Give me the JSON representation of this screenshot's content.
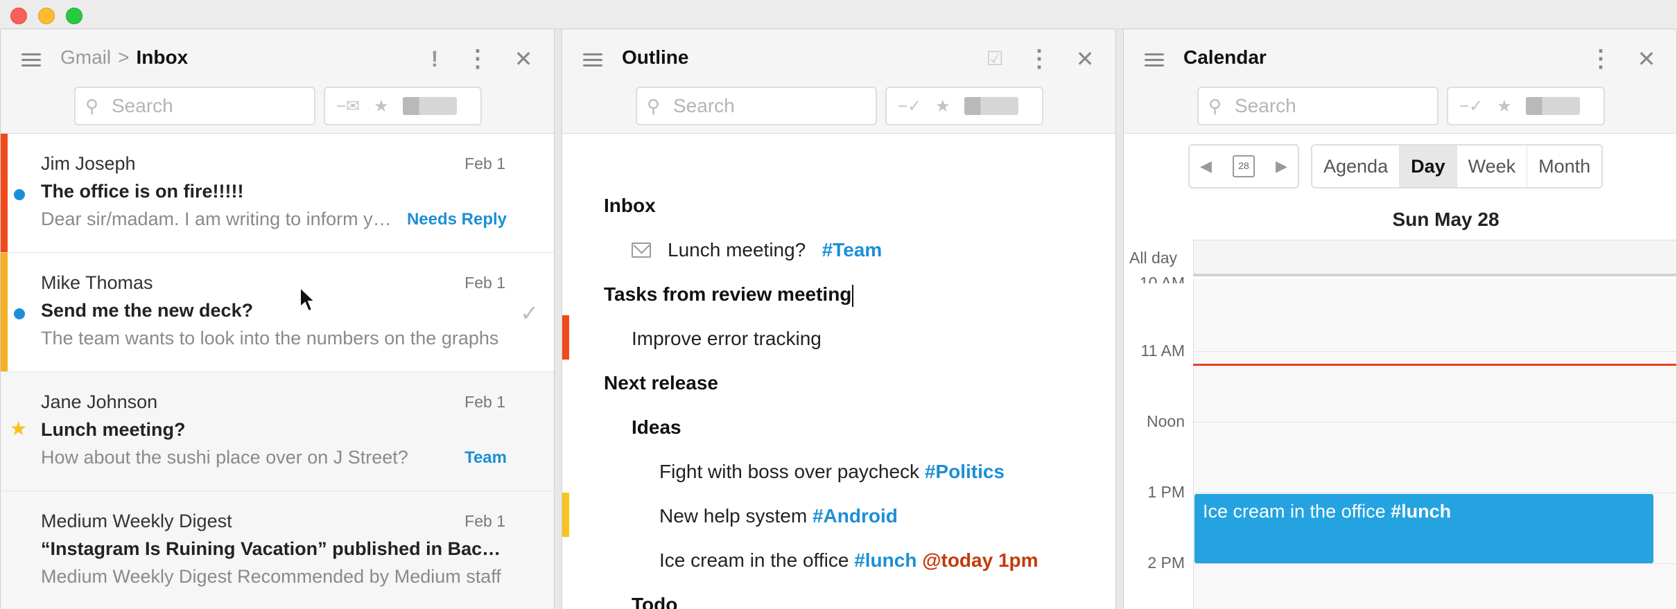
{
  "gmail": {
    "crumb_app": "Gmail",
    "crumb_sep": ">",
    "crumb_page": "Inbox",
    "search_placeholder": "Search",
    "messages": [
      {
        "from": "Jim Joseph",
        "date": "Feb 1",
        "subject": "The office is on fire!!!!!",
        "snippet": "Dear sir/madam. I am writing to inform you that the office is on fire",
        "tag": "Needs Reply",
        "stripe": "#f04a1a",
        "unread": true
      },
      {
        "from": "Mike Thomas",
        "date": "Feb 1",
        "subject": "Send me the new deck?",
        "snippet": "The team wants to look into the numbers on the graphs",
        "tag": "",
        "stripe": "#f6b021",
        "unread": true
      },
      {
        "from": "Jane Johnson",
        "date": "Feb 1",
        "subject": "Lunch meeting?",
        "snippet": "How about the sushi place over on J Street?",
        "tag": "Team",
        "stripe": "",
        "starred": true
      },
      {
        "from": "Medium Weekly Digest",
        "date": "Feb 1",
        "subject": "“Instagram Is Ruining Vacation” published in Backchannel",
        "snippet": "Medium Weekly Digest Recommended by Medium staff",
        "tag": "",
        "stripe": ""
      }
    ]
  },
  "outline": {
    "title": "Outline",
    "search_placeholder": "Search",
    "items": {
      "inbox": "Inbox",
      "lunch": "Lunch meeting?",
      "lunch_tag": "#Team",
      "tasks": "Tasks from review meeting",
      "improve": "Improve error tracking",
      "next_release": "Next release",
      "ideas": "Ideas",
      "fight": "Fight with boss over paycheck",
      "fight_tag": "#Politics",
      "help": "New help system",
      "help_tag": "#Android",
      "icecream": "Ice cream in the office",
      "icecream_tag": "#lunch",
      "icecream_at": "@today 1pm",
      "todo": "Todo"
    },
    "stripes": {
      "improve": "#f04a1a",
      "help": "#f6c51f"
    }
  },
  "calendar": {
    "title": "Calendar",
    "search_placeholder": "Search",
    "date_icon": "28",
    "views": [
      "Agenda",
      "Day",
      "Week",
      "Month"
    ],
    "active_view": "Day",
    "day_title": "Sun May 28",
    "allday_label": "All day",
    "hours": [
      "10 AM",
      "11 AM",
      "Noon",
      "1 PM",
      "2 PM"
    ],
    "event_text": "Ice cream in the office",
    "event_tag": "#lunch",
    "event_color": "#24a3e0",
    "now_color": "#e8421e"
  }
}
